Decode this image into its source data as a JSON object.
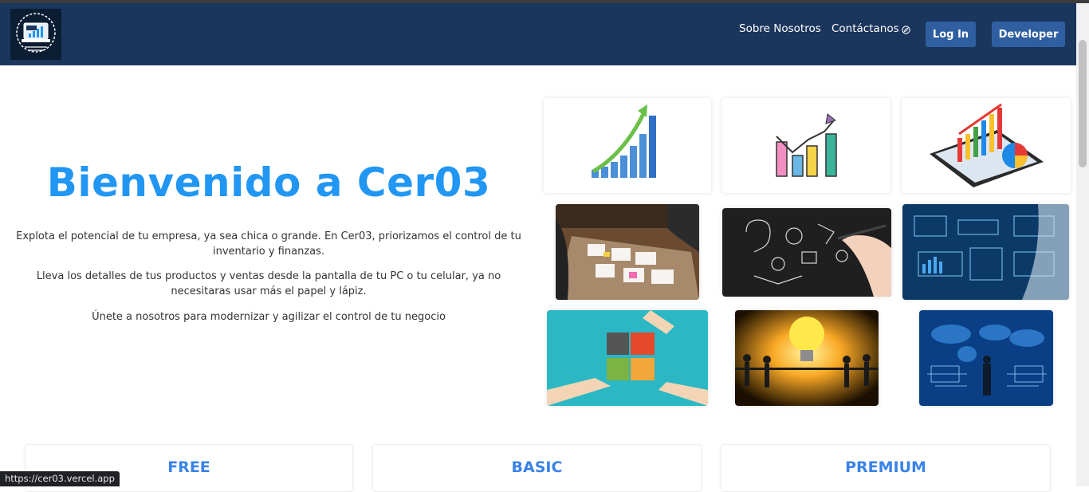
{
  "navbar": {
    "logo_text": "CER03",
    "links": [
      "Sobre Nosotros",
      "Contáctanos"
    ],
    "contact_icon": "compass-icon",
    "login_label": "Log In",
    "developer_label": "Developer"
  },
  "hero": {
    "title": "Bienvenido a Cer03",
    "paragraphs": [
      "Explota el potencial de tu empresa, ya sea chica o grande. En Cer03, priorizamos el control de tu inventario y finanzas.",
      "Lleva los detalles de tus productos y ventas desde la pantalla de tu PC o tu celular, ya no necesitaras usar más el papel y lápiz.",
      "Únete a nosotros para modernizar y agilizar el control de tu negocio"
    ]
  },
  "gallery": {
    "images": [
      "growth-bar-chart-image",
      "trend-chart-image",
      "tablet-chart-image",
      "meeting-table-image",
      "business-sketch-image",
      "big-data-image",
      "puzzle-hands-image",
      "light-bulb-team-image",
      "world-map-data-image"
    ]
  },
  "plans": [
    "FREE",
    "BASIC",
    "PREMIUM"
  ],
  "status_bar": {
    "url": "https://cer03.vercel.app"
  },
  "colors": {
    "navbar": "#1b365d",
    "button": "#2f5fa0",
    "hero_title": "#2196f3",
    "plan_title": "#3a83e8"
  }
}
